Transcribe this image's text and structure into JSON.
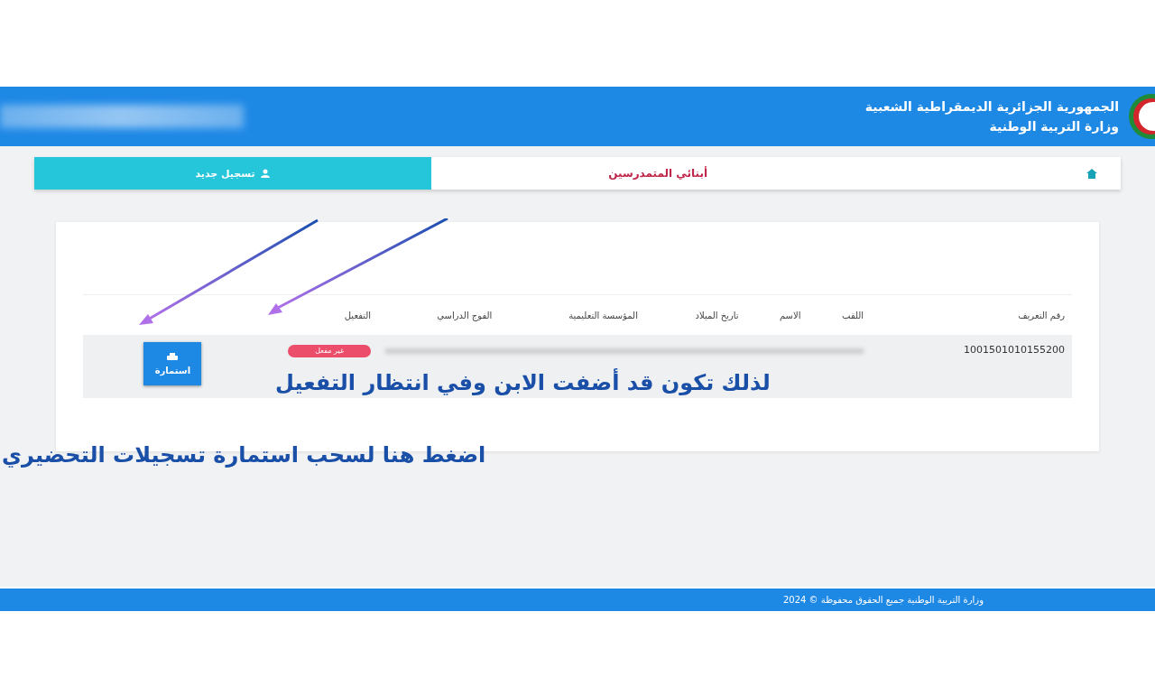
{
  "header": {
    "title": "الجمهورية الجزائرية الديمقراطية الشعبية",
    "subtitle": "وزارة التربية الوطنية"
  },
  "breadcrumb": {
    "current": "أبنائي المتمدرسين",
    "action": "تسجيل جديد"
  },
  "table": {
    "columns": [
      "رقم التعريف",
      "اللقب",
      "الاسم",
      "تاريخ الميلاد",
      "المؤسسة التعليمية",
      "الفوج الدراسي",
      "التفعيل"
    ],
    "rows": [
      {
        "id": "1001501010155200",
        "status": "غير مفعل",
        "activated": false,
        "button": "استمارة"
      }
    ]
  },
  "annotations": [
    "لذلك تكون قد أضفت الابن وفي انتظار التفعيل",
    "اضغط هنا لسحب استمارة تسجيلات التحضيري"
  ],
  "footer": "وزارة التربية الوطنية جميع الحقوق محفوظة © 2024"
}
